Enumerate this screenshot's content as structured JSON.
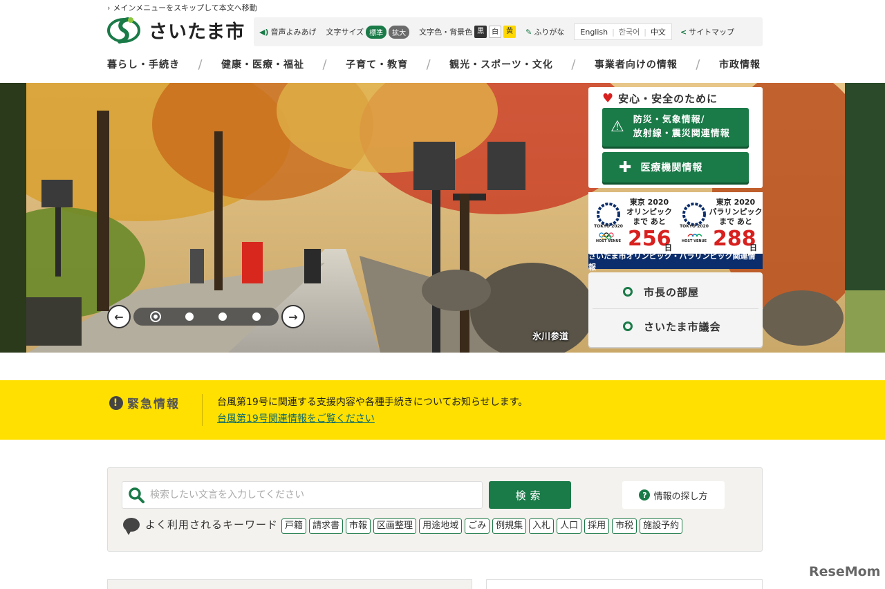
{
  "header": {
    "skip_link": "メインメニューをスキップして本文へ移動",
    "logo_text": "さいたま市"
  },
  "toolbar": {
    "voice": "音声よみあげ",
    "font_size_label": "文字サイズ",
    "font_standard": "標準",
    "font_large": "拡大",
    "color_label": "文字色・背景色",
    "color_black": "黒",
    "color_white": "白",
    "color_yellow": "黄",
    "furigana": "ふりがな",
    "lang_en": "English",
    "lang_ko": "한국어",
    "lang_zh": "中文",
    "sitemap": "サイトマップ"
  },
  "nav": {
    "items": [
      {
        "label": "暮らし・手続き"
      },
      {
        "label": "健康・医療・福祉"
      },
      {
        "label": "子育て・教育"
      },
      {
        "label": "観光・スポーツ・文化"
      },
      {
        "label": "事業者向けの情報"
      },
      {
        "label": "市政情報"
      }
    ]
  },
  "hero": {
    "caption": "氷川参道",
    "slide_count": 4,
    "active_slide": 1
  },
  "safety": {
    "title": "安心・安全のために",
    "disaster_line1": "防災・気象情報/",
    "disaster_line2": "放射線・震災関連情報",
    "medical": "医療機関情報"
  },
  "olympic": {
    "left_title1": "東京 2020",
    "left_title2": "オリンピック",
    "left_title3": "まで あと",
    "left_count": "256",
    "right_title1": "東京 2020",
    "right_title2": "パラリンピック",
    "right_title3": "まで あと",
    "right_count": "288",
    "unit": "日",
    "emblem_text": "TOKYO 2020",
    "host_venue": "HOST VENUE",
    "link": "さいたま市オリンピック・パラリンピック関連情報"
  },
  "quicklinks": {
    "mayor": "市長の部屋",
    "council": "さいたま市議会"
  },
  "emergency": {
    "label": "緊急情報",
    "text": "台風第19号に関連する支援内容や各種手続きについてお知らせします。",
    "link": "台風第19号関連情報をご覧ください"
  },
  "search": {
    "placeholder": "検索したい文言を入力してください",
    "button": "検索",
    "howto": "情報の探し方",
    "keywords_label": "よく利用されるキーワード",
    "keywords": [
      "戸籍",
      "請求書",
      "市報",
      "区画整理",
      "用途地域",
      "ごみ",
      "例規集",
      "入札",
      "人口",
      "採用",
      "市税",
      "施設予約"
    ]
  },
  "watermark": "ReseMom",
  "colors": {
    "brand_green": "#1a7a48",
    "emergency_yellow": "#ffe000",
    "alert_red": "#d8201f",
    "olympic_navy": "#0b2d6b"
  }
}
